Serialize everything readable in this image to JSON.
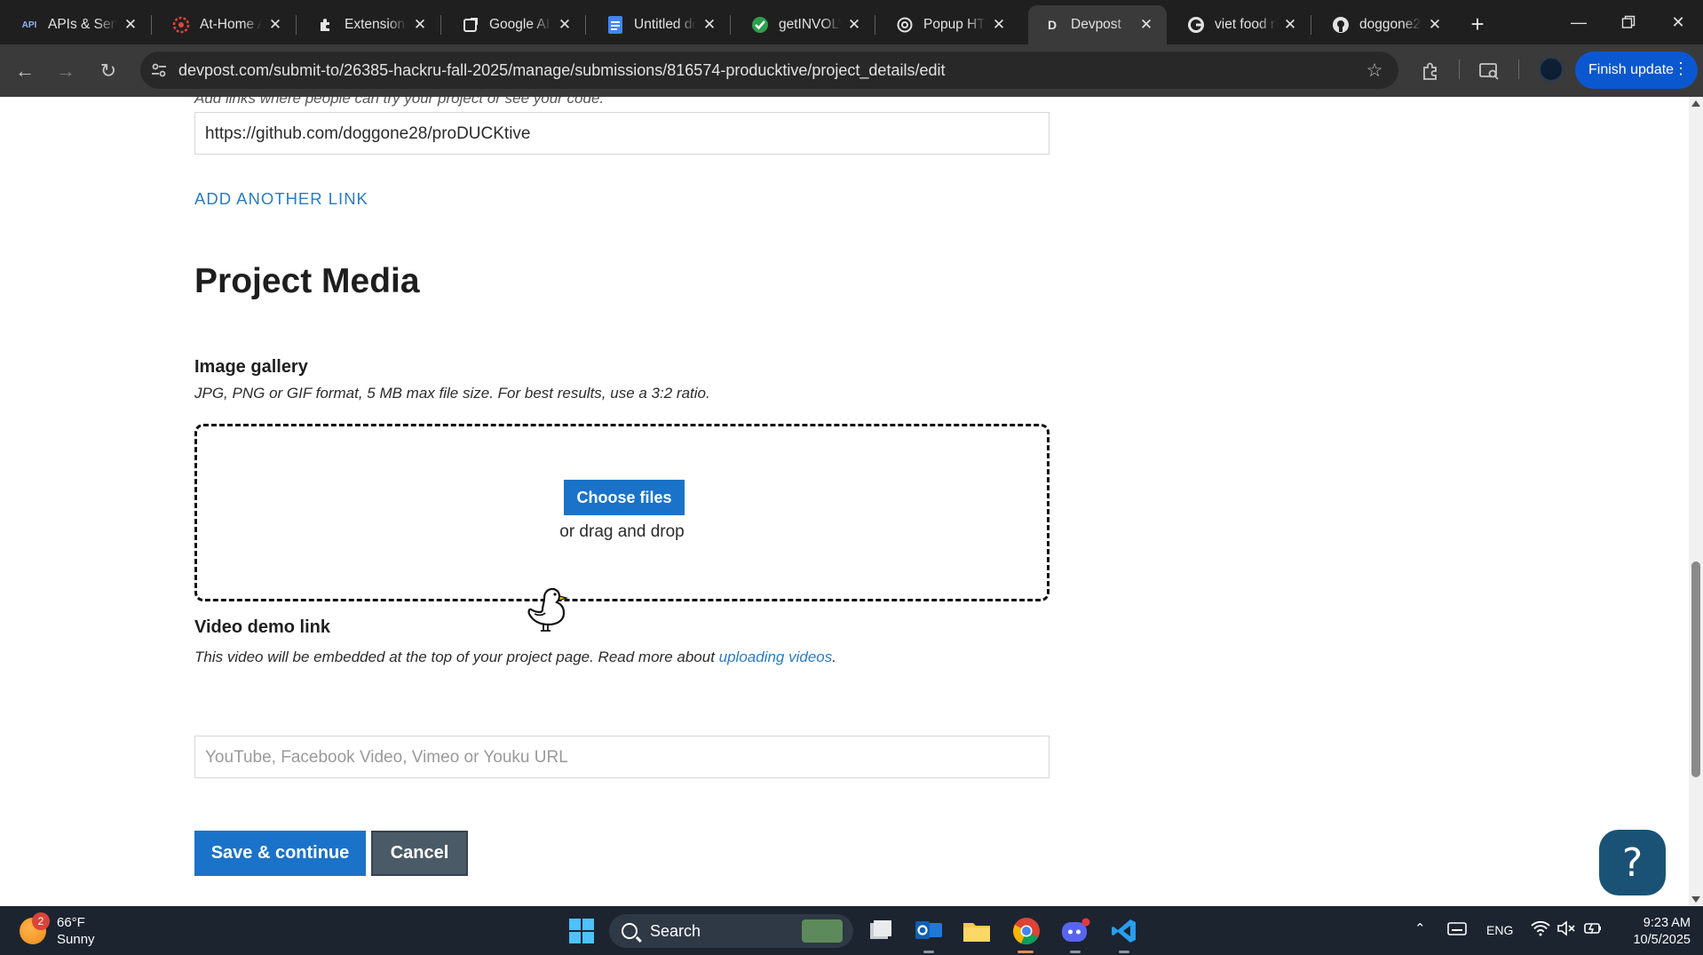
{
  "browser": {
    "tabs": [
      {
        "title": "APIs & Serv",
        "favicon": "API",
        "active": false
      },
      {
        "title": "At-Home A",
        "favicon": "target-icon",
        "active": false
      },
      {
        "title": "Extensions",
        "favicon": "puzzle-icon",
        "active": false
      },
      {
        "title": "Google AI S",
        "favicon": "ai-studio-icon",
        "active": false
      },
      {
        "title": "Untitled do",
        "favicon": "docs-icon",
        "active": false
      },
      {
        "title": "getINVOLV",
        "favicon": "check-icon",
        "active": false
      },
      {
        "title": "Popup HTM",
        "favicon": "openai-icon",
        "active": false
      },
      {
        "title": "Devpost",
        "favicon": "D",
        "active": true
      },
      {
        "title": "viet food n",
        "favicon": "google-icon",
        "active": false
      },
      {
        "title": "doggone2",
        "favicon": "github-icon",
        "active": false
      }
    ],
    "url": "devpost.com/submit-to/26385-hackru-fall-2025/manage/submissions/816574-producktive/project_details/edit",
    "finish_update_label": "Finish update"
  },
  "page": {
    "cut_off_hint": "Add links where people can try your project or see your code.",
    "link_value": "https://github.com/doggone28/proDUCKtive",
    "add_link_label": "ADD ANOTHER LINK",
    "section_title": "Project Media",
    "gallery": {
      "label": "Image gallery",
      "hint": "JPG, PNG or GIF format, 5 MB max file size. For best results, use a 3:2 ratio.",
      "choose_label": "Choose files",
      "drag_label": "or drag and drop"
    },
    "video": {
      "label": "Video demo link",
      "hint_prefix": "This video will be embedded at the top of your project page. Read more about ",
      "hint_link": "uploading videos",
      "hint_suffix": ".",
      "placeholder": "YouTube, Facebook Video, Vimeo or Youku URL"
    },
    "save_label": "Save & continue",
    "cancel_label": "Cancel",
    "help_label": "?"
  },
  "taskbar": {
    "weather_temp": "66°F",
    "weather_cond": "Sunny",
    "weather_badge": "2",
    "search_label": "Search",
    "language": "ENG",
    "time": "9:23 AM",
    "date": "10/5/2025"
  },
  "colors": {
    "accent_blue": "#1a73c8",
    "link_blue": "#2b7bc3",
    "cancel_gray": "#4a5a66",
    "help_navy": "#1a5276"
  }
}
